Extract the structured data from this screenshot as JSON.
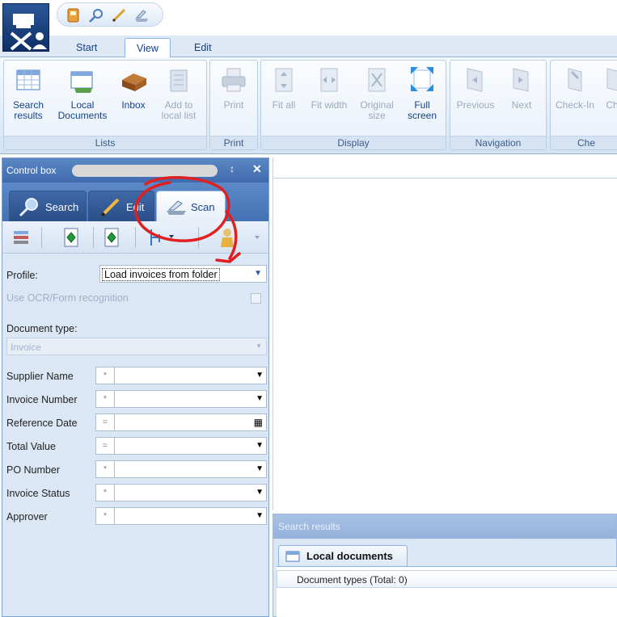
{
  "ribbon_tabs": [
    "Start",
    "View",
    "Edit"
  ],
  "active_ribbon_tab": "View",
  "ribbon": {
    "lists": {
      "label": "Lists",
      "buttons": [
        {
          "label": "Search\nresults",
          "icon": "table-icon"
        },
        {
          "label": "Local\nDocuments",
          "icon": "local-documents-icon"
        },
        {
          "label": "Inbox",
          "icon": "inbox-icon"
        },
        {
          "label": "Add to\nlocal list",
          "icon": "add-to-list-icon",
          "disabled": true
        }
      ]
    },
    "print": {
      "label": "Print",
      "buttons": [
        {
          "label": "Print",
          "icon": "printer-icon",
          "disabled": true
        }
      ]
    },
    "display": {
      "label": "Display",
      "buttons": [
        {
          "label": "Fit all",
          "icon": "fit-all-icon",
          "disabled": true
        },
        {
          "label": "Fit width",
          "icon": "fit-width-icon",
          "disabled": true
        },
        {
          "label": "Original\nsize",
          "icon": "original-size-icon",
          "disabled": true
        },
        {
          "label": "Full\nscreen",
          "icon": "full-screen-icon"
        }
      ]
    },
    "navigation": {
      "label": "Navigation",
      "buttons": [
        {
          "label": "Previous",
          "icon": "previous-icon",
          "disabled": true
        },
        {
          "label": "Next",
          "icon": "next-icon",
          "disabled": true
        }
      ]
    },
    "checkin": {
      "label": "Che",
      "buttons": [
        {
          "label": "Check-In",
          "icon": "check-in-icon",
          "disabled": true
        },
        {
          "label": "Ch",
          "icon": "check-out-icon",
          "disabled": true
        }
      ]
    }
  },
  "control_box": {
    "title": "Control box",
    "pin_glyph": "↕",
    "close_glyph": "✕",
    "tabs": [
      "Search",
      "Edit",
      "Scan"
    ],
    "active_tab": "Scan",
    "profile_label": "Profile:",
    "profile_value": "Load invoices from folder",
    "ocr_label": "Use OCR/Form recognition",
    "doctype_label": "Document type:",
    "doctype_value": "Invoice",
    "fields": [
      {
        "label": "Supplier Name",
        "op": "*"
      },
      {
        "label": "Invoice Number",
        "op": "*"
      },
      {
        "label": "Reference Date",
        "op": "="
      },
      {
        "label": "Total Value",
        "op": "="
      },
      {
        "label": "PO Number",
        "op": "*"
      },
      {
        "label": "Invoice Status",
        "op": "*"
      },
      {
        "label": "Approver",
        "op": "*"
      }
    ]
  },
  "results": {
    "header": "Search results",
    "tab_label": "Local documents",
    "row_label": "Document types (Total: 0)"
  },
  "colors": {
    "accent": "#15428b",
    "header_blue": "#4572b4",
    "annotation_red": "#e02020"
  }
}
